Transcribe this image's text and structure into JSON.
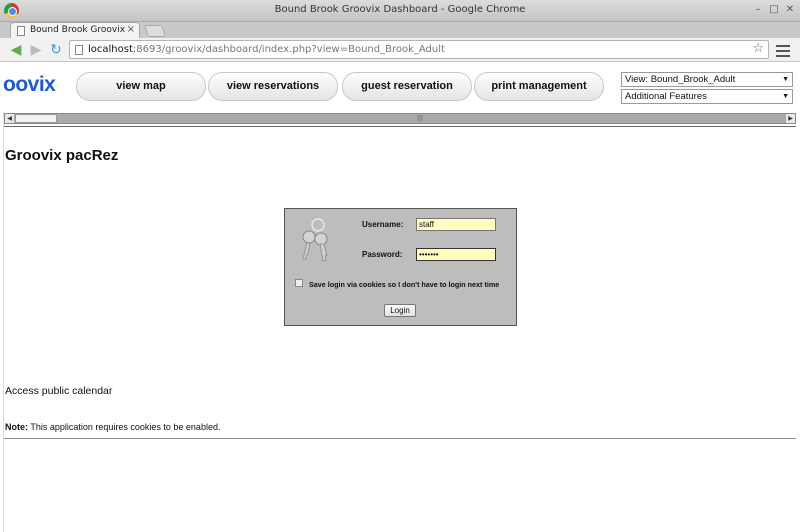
{
  "window": {
    "title": "Bound Brook Groovix Dashboard - Google Chrome"
  },
  "tab": {
    "label": "Bound Brook Groovix Dasł",
    "close": "×"
  },
  "address": {
    "host": "localhost",
    "path": ":8693/groovix/dashboard/index.php?view=Bound_Brook_Adult"
  },
  "app": {
    "logo": "oovix",
    "nav": [
      "view map",
      "view reservations",
      "guest reservation",
      "print management"
    ],
    "view_select": "View: Bound_Brook_Adult",
    "features_select": "Additional Features",
    "page_title": "Groovix pacRez"
  },
  "login": {
    "username_label": "Username:",
    "username_value": "staff",
    "password_label": "Password:",
    "password_value": "•••••••",
    "remember_label": "Save login via cookies so I don't have to login next time",
    "button_label": "Login"
  },
  "public_calendar": "Access public calendar",
  "note": {
    "bold": "Note:",
    "text": " This application requires cookies to be enabled."
  },
  "colors": {
    "logo": "#1e5ad1",
    "login_panel": "#bdbdbd",
    "input_bg": "#ffffc0"
  }
}
